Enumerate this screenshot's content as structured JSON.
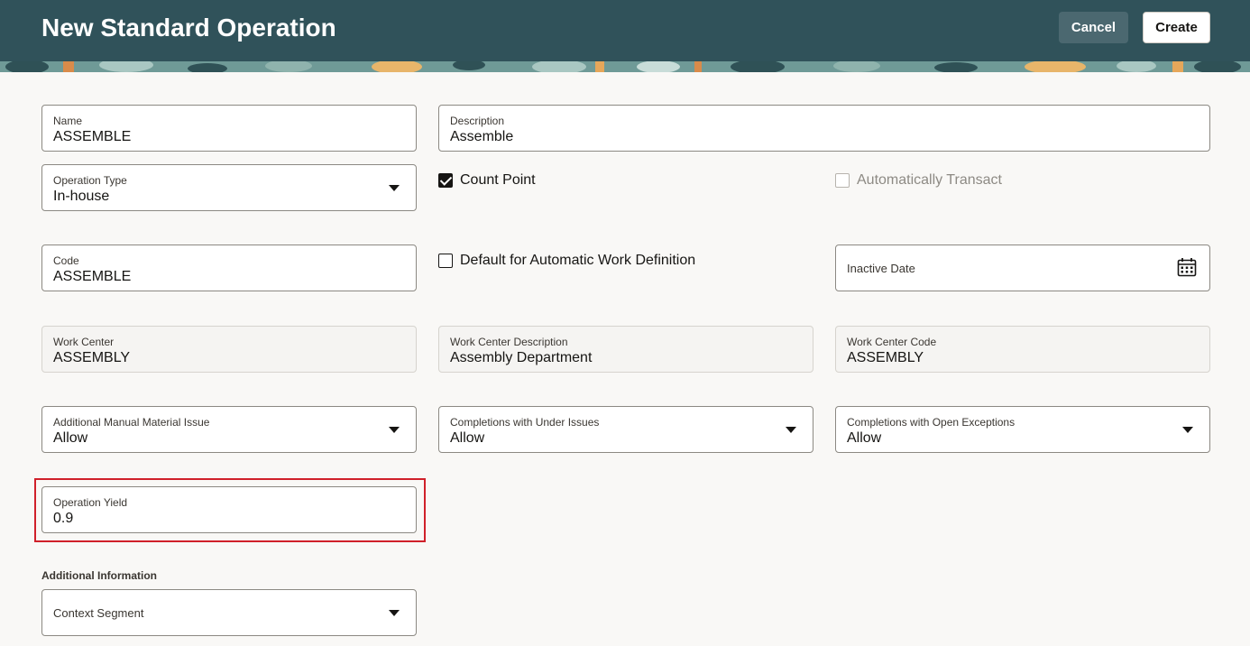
{
  "header": {
    "title": "New Standard Operation",
    "cancel_label": "Cancel",
    "create_label": "Create"
  },
  "fields": {
    "name": {
      "label": "Name",
      "value": "ASSEMBLE"
    },
    "description": {
      "label": "Description",
      "value": "Assemble"
    },
    "operation_type": {
      "label": "Operation Type",
      "value": "In-house"
    },
    "count_point": {
      "label": "Count Point",
      "checked": true
    },
    "automatically_transact": {
      "label": "Automatically Transact",
      "checked": false,
      "disabled": true
    },
    "code": {
      "label": "Code",
      "value": "ASSEMBLE"
    },
    "default_auto_work_def": {
      "label": "Default for Automatic Work Definition",
      "checked": false
    },
    "inactive_date": {
      "label": "Inactive Date",
      "value": ""
    },
    "work_center": {
      "label": "Work Center",
      "value": "ASSEMBLY"
    },
    "work_center_description": {
      "label": "Work Center Description",
      "value": "Assembly Department"
    },
    "work_center_code": {
      "label": "Work Center Code",
      "value": "ASSEMBLY"
    },
    "additional_manual_material_issue": {
      "label": "Additional Manual Material Issue",
      "value": "Allow"
    },
    "completions_under_issues": {
      "label": "Completions with Under Issues",
      "value": "Allow"
    },
    "completions_open_exceptions": {
      "label": "Completions with Open Exceptions",
      "value": "Allow"
    },
    "operation_yield": {
      "label": "Operation Yield",
      "value": "0.9"
    }
  },
  "additional_information": {
    "title": "Additional Information",
    "context_segment_label": "Context Segment"
  },
  "icons": {
    "dropdown": "chevron-down-icon",
    "calendar": "calendar-icon",
    "checkbox": "checkbox-icon"
  },
  "colors": {
    "header_bg": "#30525a",
    "highlight": "#d0202a",
    "page_bg": "#f9f8f6"
  }
}
